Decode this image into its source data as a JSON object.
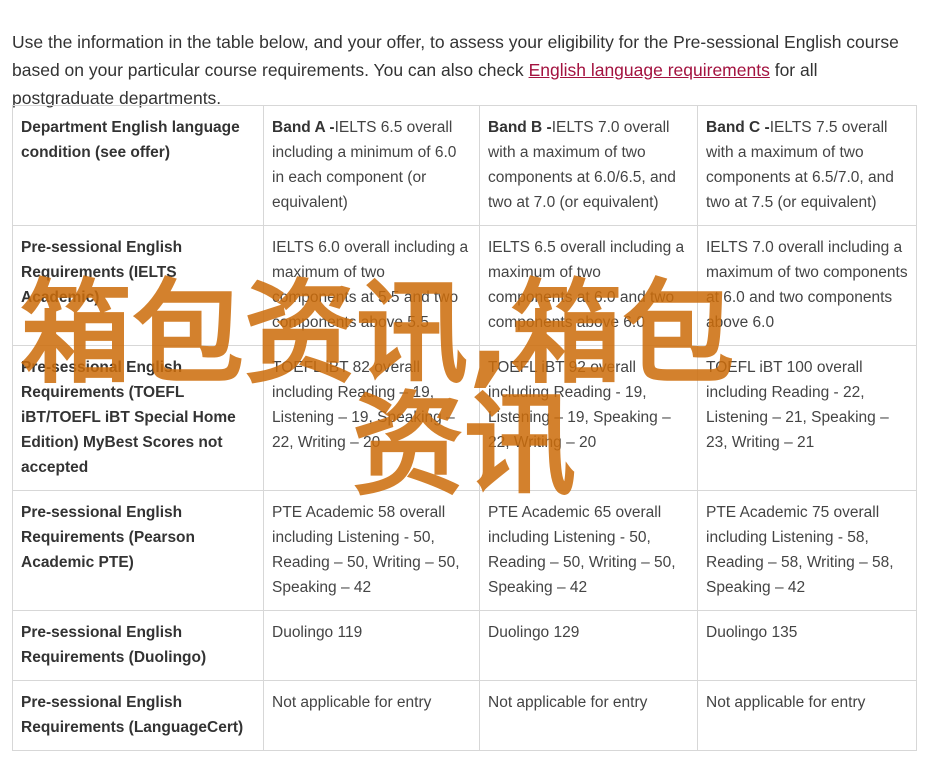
{
  "intro": {
    "before_link": "Use the information in the table below, and your offer, to assess your eligibility for the Pre-sessional English course based on your particular course requirements. You can also check ",
    "link": "English language requirements",
    "after_link": " for all postgraduate departments."
  },
  "table": {
    "header": {
      "label": "Department English language condition (see offer)",
      "bands": [
        {
          "name": "Band A -",
          "text": "IELTS 6.5 overall including a minimum of 6.0 in each component (or equivalent)"
        },
        {
          "name": "Band B -",
          "text": "IELTS 7.0 overall with a maximum of two components at 6.0/6.5, and two at 7.0 (or equivalent)"
        },
        {
          "name": "Band C -",
          "text": "IELTS 7.5 overall with a maximum of two components at 6.5/7.0, and two at 7.5 (or equivalent)"
        }
      ]
    },
    "rows": [
      {
        "label": "Pre-sessional English Requirements (IELTS Academic)",
        "cells": [
          "IELTS 6.0 overall including a maximum of two components at 5.5 and two components above 5.5",
          "IELTS 6.5 overall including a maximum of two components at 6.0 and two components above 6.0",
          "IELTS 7.0 overall including a maximum of two components at 6.0 and two components above 6.0"
        ]
      },
      {
        "label": "Pre-sessional English Requirements (TOEFL iBT/TOEFL iBT Special Home Edition) MyBest Scores not accepted",
        "cells": [
          "TOEFL iBT 82 overall including Reading – 19, Listening – 19, Speaking – 22, Writing – 20",
          "TOEFL iBT 92 overall including Reading - 19, Listening – 19, Speaking – 22, Writing – 20",
          "TOEFL iBT 100 overall including Reading - 22, Listening – 21, Speaking – 23, Writing – 21"
        ]
      },
      {
        "label": "Pre-sessional English Requirements (Pearson Academic PTE)",
        "cells": [
          "PTE Academic 58 overall including Listening - 50, Reading – 50, Writing – 50, Speaking – 42",
          "PTE Academic 65 overall including Listening - 50, Reading – 50, Writing – 50, Speaking – 42",
          "PTE Academic 75 overall including Listening - 58, Reading – 58, Writing – 58, Speaking – 42"
        ]
      },
      {
        "label": "Pre-sessional English Requirements (Duolingo)",
        "cells": [
          "Duolingo 119",
          "Duolingo 129",
          "Duolingo 135"
        ]
      },
      {
        "label": "Pre-sessional English Requirements (LanguageCert)",
        "cells": [
          "Not applicable for entry",
          "Not applicable for entry",
          "Not applicable for entry"
        ]
      }
    ]
  },
  "watermark": {
    "line1": "箱包资讯,箱包",
    "line2": "资讯",
    "color": "#cc6c0a"
  },
  "colors": {
    "link": "#a3123f",
    "text": "#333333",
    "border": "#d7d7d7"
  }
}
